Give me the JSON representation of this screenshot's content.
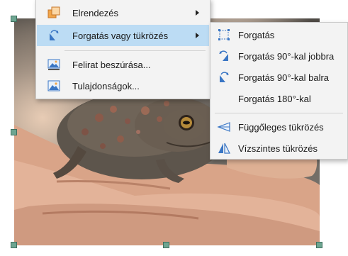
{
  "context_menu": {
    "items": [
      {
        "label": "Elrendezés",
        "icon": "arrange-icon",
        "has_submenu": true
      },
      {
        "label": "Forgatás vagy tükrözés",
        "icon": "rotate-flip-icon",
        "has_submenu": true,
        "highlighted": true
      },
      {
        "label": "Felirat beszúrása...",
        "icon": "insert-caption-icon",
        "has_submenu": false
      },
      {
        "label": "Tulajdonságok...",
        "icon": "properties-icon",
        "has_submenu": false
      }
    ]
  },
  "submenu": {
    "items": [
      {
        "label": "Forgatás",
        "icon": "rotate-icon"
      },
      {
        "label": "Forgatás 90°-kal jobbra",
        "icon": "rotate-right-icon"
      },
      {
        "label": "Forgatás 90°-kal balra",
        "icon": "rotate-left-icon"
      },
      {
        "label": "Forgatás 180°-kal",
        "icon": ""
      },
      {
        "label": "Függőleges tükrözés",
        "icon": "flip-vertical-icon"
      },
      {
        "label": "Vízszintes tükrözés",
        "icon": "flip-horizontal-icon"
      }
    ]
  },
  "colors": {
    "highlight": "#bcdcf4",
    "menu_background": "#f3f3f3",
    "handle": "#6da591",
    "icon_blue": "#3a76c4"
  }
}
